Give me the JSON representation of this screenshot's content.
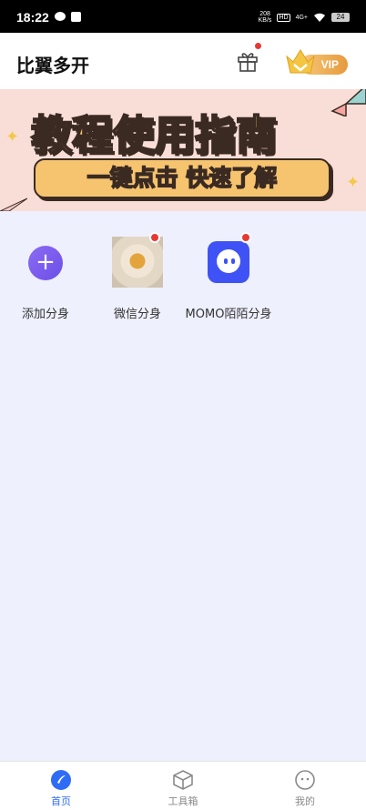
{
  "status_bar": {
    "time": "18:22",
    "net_speed_top": "208",
    "net_speed_unit": "KB/s",
    "hd": "HD",
    "network": "4G+",
    "battery": "24"
  },
  "app_bar": {
    "title": "比翼多开",
    "vip_label": "VIP"
  },
  "banner": {
    "headline": "教程使用指南",
    "subline": "一键点击 快速了解"
  },
  "apps": [
    {
      "label": "添加分身",
      "icon": "plus-icon"
    },
    {
      "label": "微信分身",
      "icon": "flower-thumbnail"
    },
    {
      "label": "MOMO陌陌分身",
      "icon": "momo-icon"
    }
  ],
  "tabs": [
    {
      "label": "首页",
      "icon": "home-icon",
      "active": true
    },
    {
      "label": "工具箱",
      "icon": "cube-icon",
      "active": false
    },
    {
      "label": "我的",
      "icon": "smiley-icon",
      "active": false
    }
  ],
  "colors": {
    "accent": "#2f6cf5",
    "background": "#eef0fd",
    "banner_bg": "#f9ded8",
    "badge": "#e53935"
  }
}
